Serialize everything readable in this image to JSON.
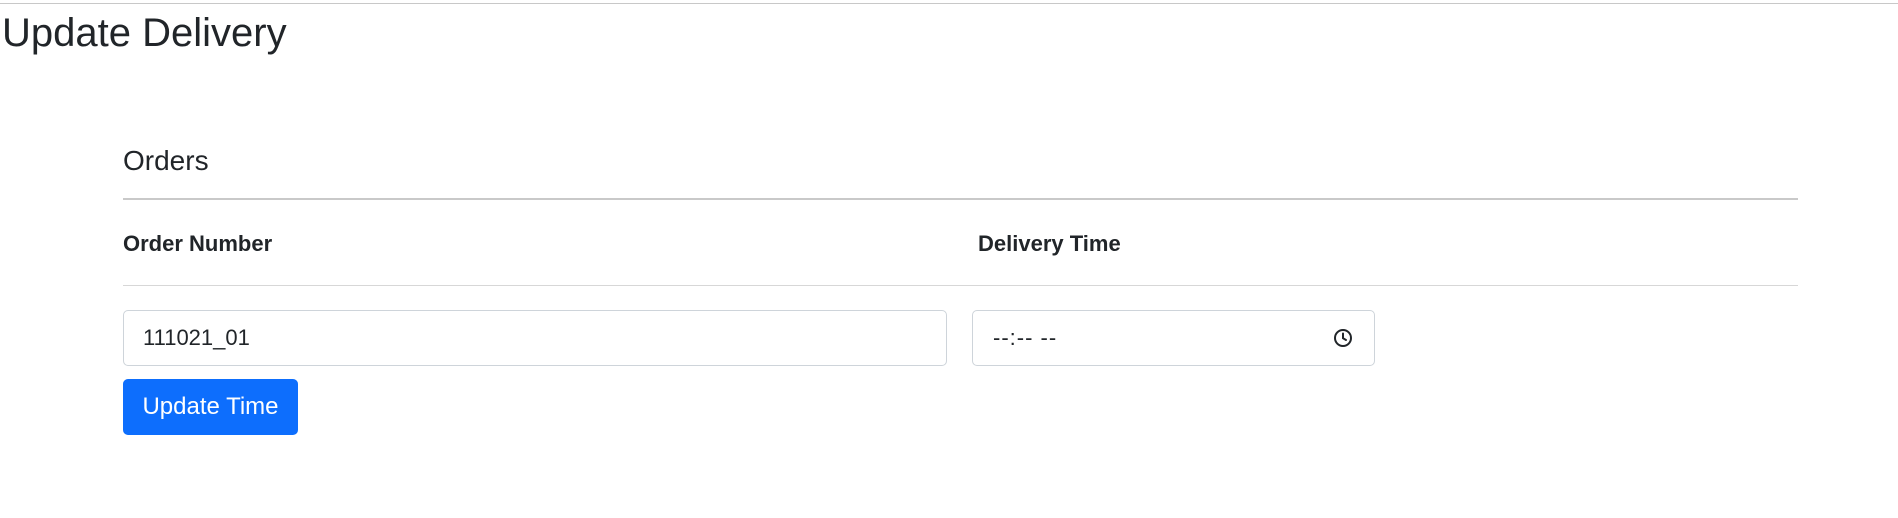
{
  "page": {
    "title": "Update Delivery"
  },
  "orders": {
    "section_title": "Orders",
    "columns": {
      "order_number": "Order Number",
      "delivery_time": "Delivery Time"
    },
    "row": {
      "order_number_value": "111021_01",
      "delivery_time_placeholder": "--:-- --"
    },
    "update_button_label": "Update Time"
  },
  "colors": {
    "primary_button": "#0d6efd",
    "text": "#212529",
    "border": "#ced4da"
  },
  "icons": {
    "time_field_icon": "clock-icon"
  }
}
